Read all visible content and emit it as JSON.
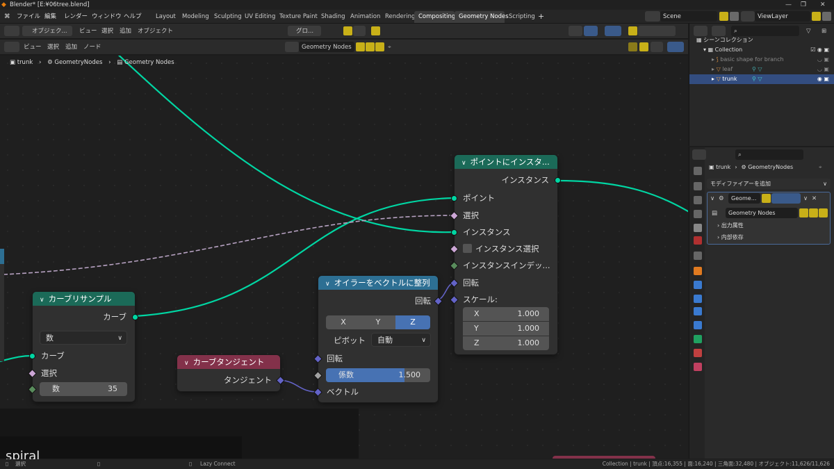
{
  "titlebar": {
    "title": "Blender* [E:¥06tree.blend]",
    "minimize": "—",
    "maximize": "❐",
    "close": "✕"
  },
  "menu": {
    "items": [
      "ファイル",
      "編集",
      "レンダー",
      "ウィンドウ",
      "ヘルプ"
    ]
  },
  "workspaces": [
    "Layout",
    "Modeling",
    "Sculpting",
    "UV Editing",
    "Texture Paint",
    "Shading",
    "Animation",
    "Rendering",
    "Compositing",
    "Geometry Nodes",
    "Scripting"
  ],
  "workspace_add": "+",
  "scene": {
    "name": "Scene",
    "view_layer": "ViewLayer"
  },
  "viewport_header": {
    "mode": "オブジェク...",
    "items": [
      "ビュー",
      "選択",
      "追加",
      "オブジェクト"
    ],
    "transform": "グロ..."
  },
  "node_header": {
    "items": [
      "ビュー",
      "選択",
      "追加",
      "ノード"
    ],
    "node_group": "Geometry Nodes"
  },
  "breadcrumb": {
    "object": "trunk",
    "modifier": "GeometryNodes",
    "tree": "Geometry Nodes"
  },
  "nodes": {
    "instance_on_points": {
      "title": "ポイントにインスタ...",
      "output": "インスタンス",
      "inputs": [
        "ポイント",
        "選択",
        "インスタンス"
      ],
      "instance_select": "インスタンス選択",
      "instance_index": "インスタンスインデッ...",
      "rotation": "回転",
      "scale_label": "スケール:",
      "scale": [
        {
          "axis": "X",
          "value": "1.000"
        },
        {
          "axis": "Y",
          "value": "1.000"
        },
        {
          "axis": "Z",
          "value": "1.000"
        }
      ]
    },
    "align_euler": {
      "title": "オイラーをベクトルに整列",
      "output": "回転",
      "axes": [
        "X",
        "Y",
        "Z"
      ],
      "pivot_label": "ピボット",
      "pivot_value": "自動",
      "rotation": "回転",
      "factor_label": "係数",
      "factor_value": "1.500",
      "factor_fill": 0.75,
      "vector": "ベクトル"
    },
    "curve_tangent": {
      "title": "カーブタンジェント",
      "output": "タンジェント"
    },
    "resample_curve": {
      "title": "カーブリサンプル",
      "output": "カーブ",
      "mode": "数",
      "inputs": [
        "カーブ",
        "選択"
      ],
      "count_label": "数",
      "count_value": "35"
    }
  },
  "canvas_overlay_text": "spiral",
  "outliner": {
    "header": "シーンコレクション",
    "collection": "Collection",
    "items": [
      "basic shape for branch",
      "leaf",
      "trunk"
    ]
  },
  "properties": {
    "breadcrumb_object": "trunk",
    "breadcrumb_modifier": "GeometryNodes",
    "add_modifier": "モディファイアーを追加",
    "modifier_name": "Geome...",
    "node_group": "Geometry Nodes",
    "panels": [
      "出力属性",
      "内部依存"
    ]
  },
  "statusbar": {
    "left": "選択",
    "middle": "Lazy Connect",
    "right": "Collection | trunk | 頂点:16,355 | 面:16,240 | 三角面:32,480 | オブジェクト:11,626/11,626"
  },
  "colors": {
    "geometry": "#00d6a3",
    "vector": "#6363c7",
    "selection": "#cca6d6",
    "header_geo": "#1b6a58",
    "header_conv": "#2d6f93",
    "header_input": "#83314a"
  }
}
